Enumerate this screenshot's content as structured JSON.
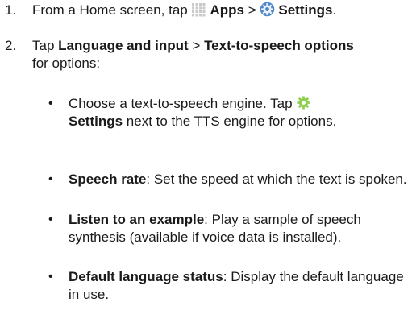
{
  "steps": [
    {
      "number": "1.",
      "text_prefix": "From a Home screen, tap",
      "apps_label": "Apps",
      "sep": ">",
      "settings_label": "Settings",
      "end": "."
    },
    {
      "number": "2.",
      "prefix": "Tap",
      "language_label": "Language and input",
      "sep": ">",
      "tts_label": "Text-to-speech options",
      "suffix": "for options:"
    }
  ],
  "bullets": [
    {
      "line1": "Choose a text-to-speech engine. Tap",
      "settings_label": "Settings",
      "rest": "next to the TTS engine for options."
    },
    {
      "term": "Speech rate",
      "desc": ": Set the speed at which the text is spoken."
    },
    {
      "term": "Listen to an example",
      "desc": ": Play a sample of speech synthesis (available if voice data is installed)."
    },
    {
      "term": "Default language status",
      "desc": ": Display the default language in use."
    }
  ],
  "bullet_glyph": "•",
  "icons": {
    "apps": "apps-grid-icon",
    "settings_blue": "settings-gear-icon",
    "settings_small": "settings-gear-small-icon"
  },
  "colors": {
    "text": "#1a1a1a",
    "apps_icon": "#c9c9c9",
    "settings_icon_blue": "#4f86c6",
    "settings_icon_green": "#8fcf4f"
  }
}
